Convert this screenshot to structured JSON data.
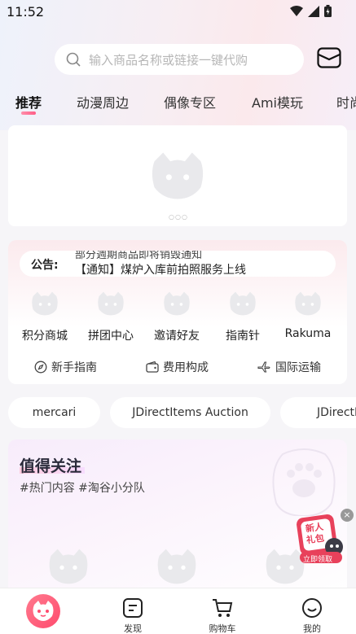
{
  "status_bar": {
    "time": "11:52"
  },
  "search": {
    "placeholder": "输入商品名称或链接一键代购"
  },
  "tabs": [
    {
      "label": "推荐",
      "active": true
    },
    {
      "label": "动漫周边"
    },
    {
      "label": "偶像专区"
    },
    {
      "label": "Ami模玩"
    },
    {
      "label": "时尚"
    }
  ],
  "notice": {
    "label": "公告:",
    "line_prev": "部分週期商品即将销毁通知",
    "line_current": "【通知】煤炉入库前拍照服务上线"
  },
  "quick_links": [
    {
      "label": "积分商城"
    },
    {
      "label": "拼团中心"
    },
    {
      "label": "邀请好友"
    },
    {
      "label": "指南针"
    },
    {
      "label": "Rakuma"
    }
  ],
  "help_links": [
    {
      "label": "新手指南",
      "icon": "compass-icon"
    },
    {
      "label": "费用构成",
      "icon": "wallet-icon"
    },
    {
      "label": "国际运输",
      "icon": "plane-icon"
    }
  ],
  "platform_pills": [
    {
      "label": "mercari"
    },
    {
      "label": "JDirectItems Auction"
    },
    {
      "label": "JDirectItems"
    }
  ],
  "featured": {
    "title": "值得关注",
    "tags": "#热门内容 #淘谷小分队"
  },
  "gift": {
    "line1": "新人",
    "line2": "礼包",
    "cta": "立即领取"
  },
  "bottom_nav": [
    {
      "label": "",
      "icon": "home-cat-icon"
    },
    {
      "label": "发现",
      "icon": "discover-icon"
    },
    {
      "label": "购物车",
      "icon": "cart-icon"
    },
    {
      "label": "我的",
      "icon": "smile-icon"
    }
  ],
  "colors": {
    "accent": "#ff5d86",
    "background": "#f6f5f8",
    "placeholder_icon": "#e8e8ec"
  }
}
